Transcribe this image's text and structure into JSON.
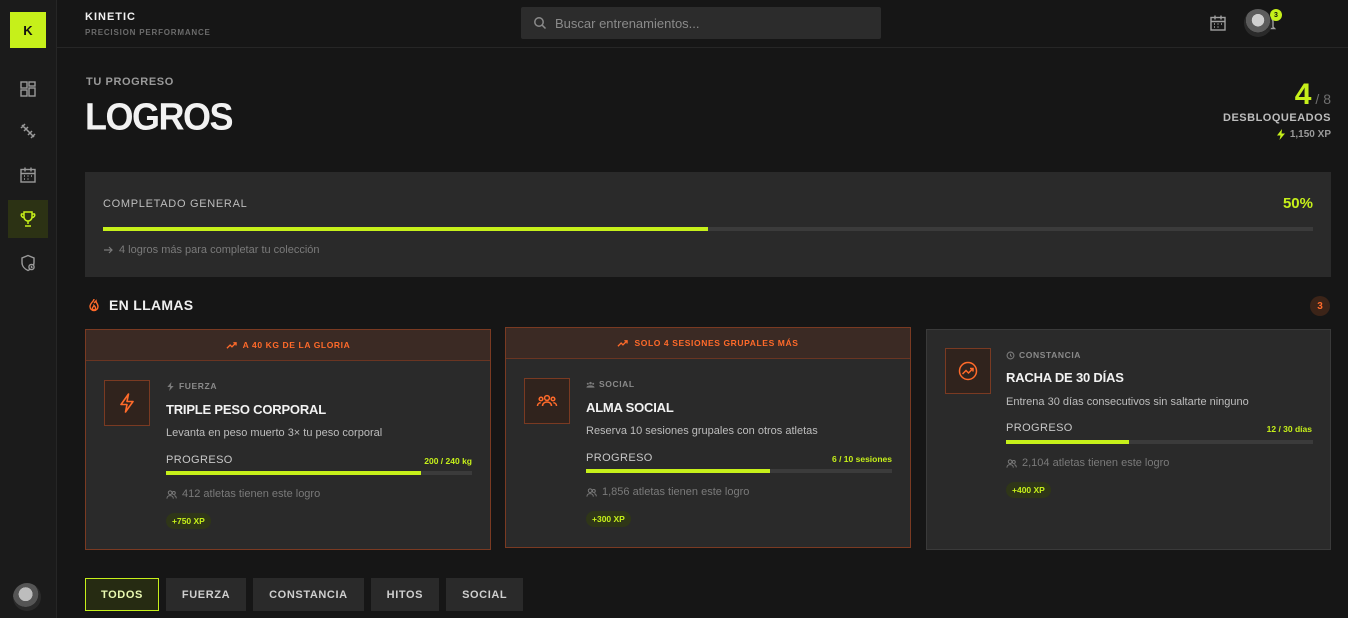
{
  "brand": {
    "logo_letter": "K",
    "name": "KINETIC",
    "tagline": "PRECISION PERFORMANCE"
  },
  "search": {
    "placeholder": "Buscar entrenamientos..."
  },
  "notifications": {
    "count": "3"
  },
  "header": {
    "eyebrow": "TU PROGRESO",
    "title": "LOGROS"
  },
  "stats": {
    "unlocked": "4",
    "total": "/ 8",
    "label": "DESBLOQUEADOS",
    "xp": "1,150 XP"
  },
  "overall": {
    "label": "COMPLETADO GENERAL",
    "percent_text": "50%",
    "percent": 0.5,
    "hint": "4 logros más para completar tu colección"
  },
  "section": {
    "title": "EN LLAMAS",
    "count": "3"
  },
  "cards": [
    {
      "banner": "A 40 KG DE LA GLORIA",
      "category": "FUERZA",
      "icon": "bolt-icon",
      "title": "TRIPLE PESO CORPORAL",
      "description": "Levanta en peso muerto 3× tu peso corporal",
      "progress_label": "PROGRESO",
      "progress_value": "200 / 240 kg",
      "progress": 0.8333,
      "athletes": "412 atletas tienen este logro",
      "xp": "+750 XP"
    },
    {
      "banner": "SOLO 4 SESIONES GRUPALES MÁS",
      "category": "SOCIAL",
      "icon": "group-icon",
      "title": "ALMA SOCIAL",
      "description": "Reserva 10 sesiones grupales con otros atletas",
      "progress_label": "PROGRESO",
      "progress_value": "6 / 10 sesiones",
      "progress": 0.6,
      "athletes": "1,856 atletas tienen este logro",
      "xp": "+300 XP"
    },
    {
      "category": "CONSTANCIA",
      "icon": "trending-up-icon",
      "title": "RACHA DE 30 DÍAS",
      "description": "Entrena 30 días consecutivos sin saltarte ninguno",
      "progress_label": "PROGRESO",
      "progress_value": "12 / 30 días",
      "progress": 0.4,
      "athletes": "2,104 atletas tienen este logro",
      "xp": "+400 XP"
    }
  ],
  "filters": [
    "TODOS",
    "FUERZA",
    "CONSTANCIA",
    "HITOS",
    "SOCIAL"
  ],
  "colors": {
    "accent": "#c6f01a",
    "fire": "#ff6a2a",
    "background": "#161616",
    "panel": "#2a2a2a"
  }
}
